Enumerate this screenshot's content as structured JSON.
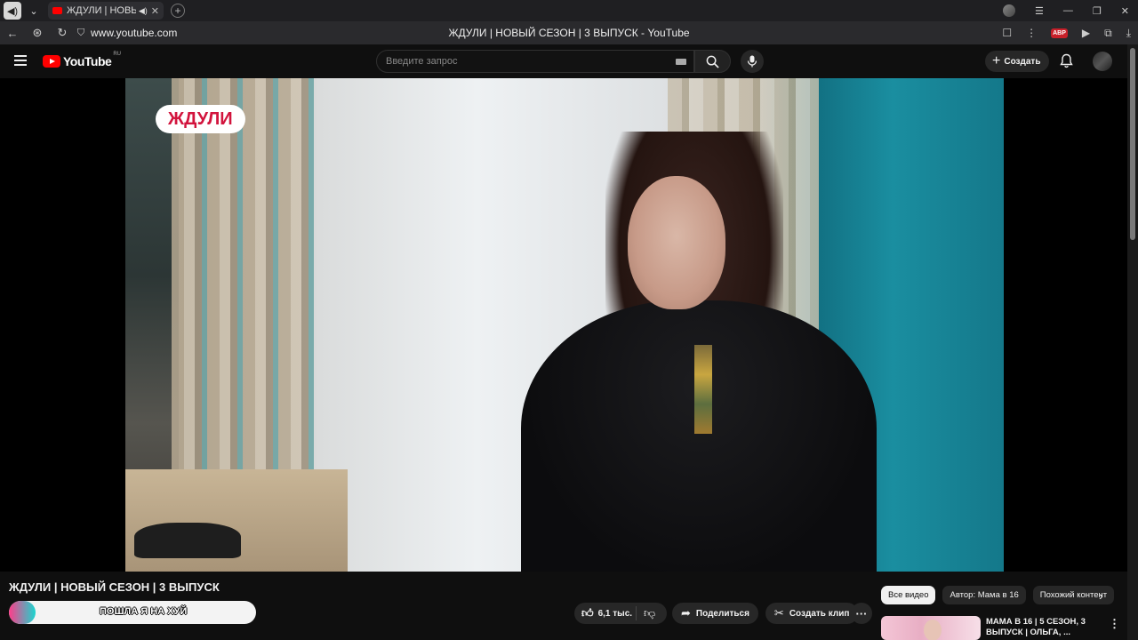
{
  "browser": {
    "tab_title": "ЖДУЛИ | НОВЫЙ С",
    "url": "www.youtube.com",
    "window_title": "ЖДУЛИ | НОВЫЙ СЕЗОН | 3 ВЫПУСК - YouTube",
    "abp_label": "ABP"
  },
  "youtube": {
    "logo_text": "YouTube",
    "country_code": "RU",
    "search_placeholder": "Введите запрос",
    "create_label": "Создать"
  },
  "video": {
    "badge": "ЖДУЛИ",
    "title": "ЖДУЛИ | НОВЫЙ СЕЗОН | 3 ВЫПУСК",
    "channel_overlay_text": "ПОШЛА Я НА ХУЙ",
    "channel_hidden": "Мама в 16"
  },
  "actions": {
    "likes": "6,1 тыс.",
    "share": "Поделиться",
    "clip": "Создать клип"
  },
  "chips": [
    "Все видео",
    "Автор: Мама в 16",
    "Похожий контент"
  ],
  "recommendation": {
    "title": "МАМА В 16 | 5 СЕЗОН, 3 ВЫПУСК | ОЛЬГА, ..."
  }
}
